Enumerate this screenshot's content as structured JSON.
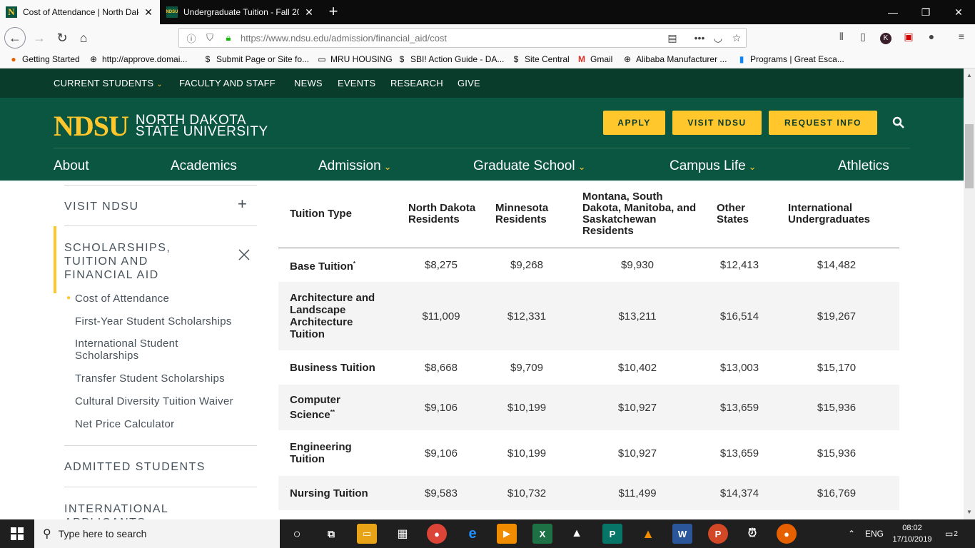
{
  "browser": {
    "tabs": [
      {
        "title": "Cost of Attendance | North Dak",
        "close": "✕"
      },
      {
        "title": "Undergraduate Tuition - Fall 20",
        "close": "✕"
      }
    ],
    "new_tab": "+",
    "window_controls": {
      "minimize": "—",
      "restore": "❐",
      "close": "✕"
    },
    "url": "https://www.ndsu.edu/admission/financial_aid/cost",
    "bookmarks": [
      {
        "label": "Getting Started",
        "icon": "firefox-icon"
      },
      {
        "label": "http://approve.domai...",
        "icon": "globe-icon"
      },
      {
        "label": "Submit Page or Site fo...",
        "icon": "s-icon"
      },
      {
        "label": "MRU HOUSING",
        "icon": "folder-icon"
      },
      {
        "label": "SBI! Action Guide - DA...",
        "icon": "s-icon"
      },
      {
        "label": "Site Central",
        "icon": "s-icon"
      },
      {
        "label": "Gmail",
        "icon": "gmail-icon"
      },
      {
        "label": "Alibaba Manufacturer ...",
        "icon": "globe-icon"
      },
      {
        "label": "Programs | Great Esca...",
        "icon": "bookmark-icon"
      }
    ]
  },
  "site": {
    "utility_nav": [
      {
        "label": "CURRENT STUDENTS",
        "has_menu": true
      },
      {
        "label": "FACULTY AND STAFF"
      },
      {
        "label": "NEWS"
      },
      {
        "label": "EVENTS"
      },
      {
        "label": "RESEARCH"
      },
      {
        "label": "GIVE"
      }
    ],
    "logo": {
      "mark": "NDSU",
      "line1": "NORTH DAKOTA",
      "line2": "STATE UNIVERSITY"
    },
    "cta_buttons": [
      "APPLY",
      "VISIT NDSU",
      "REQUEST INFO"
    ],
    "main_nav": [
      {
        "label": "About"
      },
      {
        "label": "Academics"
      },
      {
        "label": "Admission",
        "has_menu": true
      },
      {
        "label": "Graduate School",
        "has_menu": true
      },
      {
        "label": "Campus Life",
        "has_menu": true
      },
      {
        "label": "Athletics"
      }
    ]
  },
  "sidebar": {
    "visit": "VISIT NDSU",
    "scholarships_section": "SCHOLARSHIPS, TUITION AND FINANCIAL AID",
    "links": [
      "Cost of Attendance",
      "First-Year Student Scholarships",
      "International Student Scholarships",
      "Transfer Student Scholarships",
      "Cultural Diversity Tuition Waiver",
      "Net Price Calculator"
    ],
    "admitted": "ADMITTED STUDENTS",
    "international": "INTERNATIONAL APPLICANTS"
  },
  "table": {
    "headers": [
      "Tuition Type",
      "North Dakota Residents",
      "Minnesota Residents",
      "Montana, South Dakota, Manitoba, and Saskatchewan Residents",
      "Other States",
      "International Undergraduates"
    ],
    "rows": [
      {
        "type": "Base Tuition",
        "mark": "*",
        "values": [
          "$8,275",
          "$9,268",
          "$9,930",
          "$12,413",
          "$14,482"
        ]
      },
      {
        "type": "Architecture and Landscape Architecture Tuition",
        "mark": "",
        "values": [
          "$11,009",
          "$12,331",
          "$13,211",
          "$16,514",
          "$19,267"
        ]
      },
      {
        "type": "Business Tuition",
        "mark": "",
        "values": [
          "$8,668",
          "$9,709",
          "$10,402",
          "$13,003",
          "$15,170"
        ]
      },
      {
        "type": "Computer Science",
        "mark": "**",
        "values": [
          "$9,106",
          "$10,199",
          "$10,927",
          "$13,659",
          "$15,936"
        ]
      },
      {
        "type": "Engineering Tuition",
        "mark": "",
        "values": [
          "$9,106",
          "$10,199",
          "$10,927",
          "$13,659",
          "$15,936"
        ]
      },
      {
        "type": "Nursing Tuition",
        "mark": "",
        "values": [
          "$9,583",
          "$10,732",
          "$11,499",
          "$14,374",
          "$16,769"
        ]
      }
    ]
  },
  "taskbar": {
    "search_placeholder": "Type here to search",
    "language": "ENG",
    "time": "08:02",
    "date": "17/10/2019",
    "notifications": "2"
  },
  "colors": {
    "brand_green": "#0a5640",
    "dark_green": "#0a3c2c",
    "brand_gold": "#ffc72c"
  }
}
